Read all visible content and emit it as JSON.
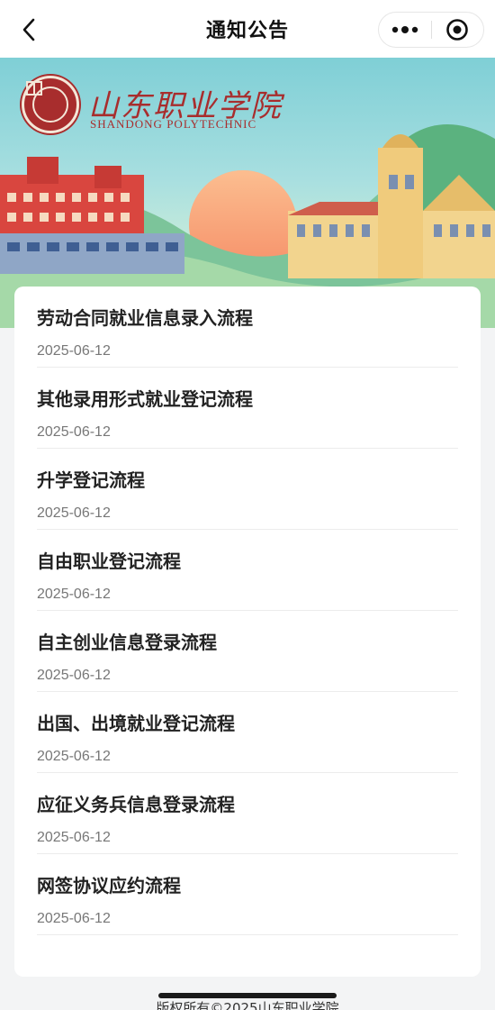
{
  "navbar": {
    "title": "通知公告",
    "back_icon": "chevron-left-icon",
    "more_icon": "more-dots-icon",
    "close_icon": "target-close-icon"
  },
  "banner": {
    "school_name_cn": "山东职业学院",
    "school_name_en": "SHANDONG POLYTECHNIC",
    "logo_icon": "school-seal-icon",
    "colors": {
      "sky": "#7fcfd6",
      "brand": "#a82d2d",
      "sun": "#f7a37a"
    }
  },
  "notices": [
    {
      "title": "劳动合同就业信息录入流程",
      "date": "2025-06-12"
    },
    {
      "title": "其他录用形式就业登记流程",
      "date": "2025-06-12"
    },
    {
      "title": "升学登记流程",
      "date": "2025-06-12"
    },
    {
      "title": "自由职业登记流程",
      "date": "2025-06-12"
    },
    {
      "title": "自主创业信息登录流程",
      "date": "2025-06-12"
    },
    {
      "title": "出国、出境就业登记流程",
      "date": "2025-06-12"
    },
    {
      "title": "应征义务兵信息登录流程",
      "date": "2025-06-12"
    },
    {
      "title": "网签协议应约流程",
      "date": "2025-06-12"
    }
  ],
  "footer": {
    "copyright": "版权所有©2025山东职业学院"
  }
}
